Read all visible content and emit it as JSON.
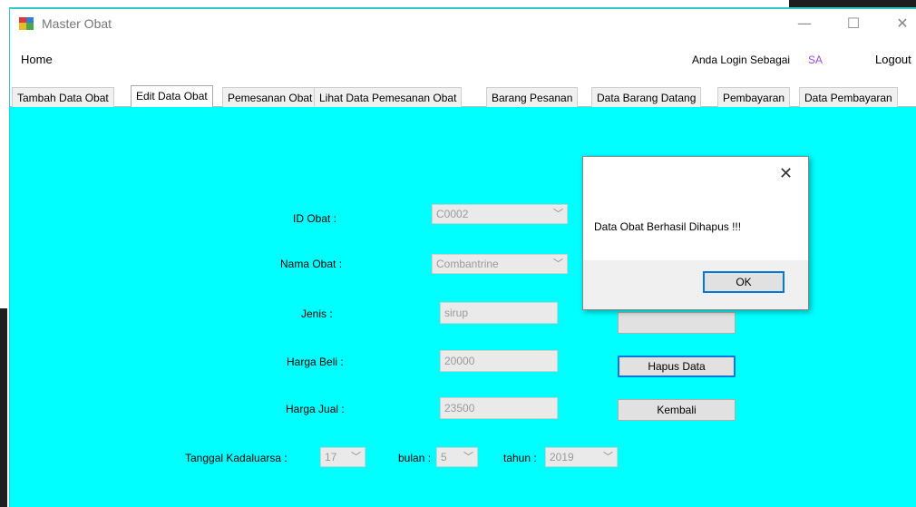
{
  "window": {
    "title": "Master Obat",
    "controls": {
      "minimize": "—",
      "maximize": "☐",
      "close": "✕"
    }
  },
  "menu": {
    "home": "Home",
    "login_label": "Anda Login Sebagai",
    "login_user": "SA",
    "logout": "Logout"
  },
  "tabs": [
    {
      "label": "Tambah Data Obat"
    },
    {
      "label": "Edit Data Obat"
    },
    {
      "label": "Pemesanan Obat"
    },
    {
      "label": "Lihat Data Pemesanan Obat"
    },
    {
      "label": "Barang Pesanan"
    },
    {
      "label": "Data Barang Datang"
    },
    {
      "label": "Pembayaran"
    },
    {
      "label": "Data Pembayaran"
    }
  ],
  "active_tab": "Edit Data Obat",
  "form": {
    "id_obat_label": "ID Obat :",
    "id_obat_value": "C0002",
    "nama_obat_label": "Nama Obat :",
    "nama_obat_value": "Combantrine",
    "jenis_label": "Jenis :",
    "jenis_value": "sirup",
    "harga_beli_label": "Harga Beli :",
    "harga_beli_value": "20000",
    "harga_jual_label": "Harga Jual :",
    "harga_jual_value": "23500",
    "tanggal_label": "Tanggal Kadaluarsa :",
    "tanggal_value": "17",
    "bulan_label": "bulan :",
    "bulan_value": "5",
    "tahun_label": "tahun :",
    "tahun_value": "2019"
  },
  "buttons": {
    "hapus": "Hapus Data",
    "kembali": "Kembali"
  },
  "dialog": {
    "message": "Data Obat Berhasil Dihapus !!!",
    "ok": "OK",
    "close": "✕"
  },
  "colors": {
    "content_bg": "#00ffff",
    "accent": "#0078d7",
    "login_user": "#a24bd0"
  }
}
